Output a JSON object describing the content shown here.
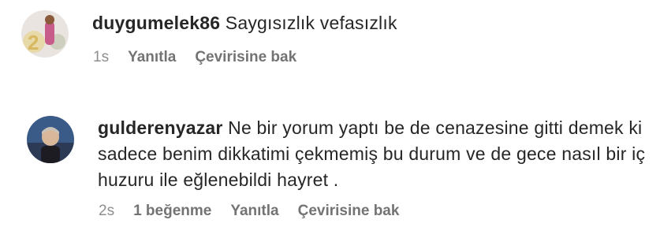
{
  "comments": [
    {
      "username": "duygumelek86",
      "text": "Saygısızlık vefasızlık",
      "time": "1s",
      "reply_label": "Yanıtla",
      "translate_label": "Çevirisine bak"
    },
    {
      "username": "gulderenyazar",
      "text": "Ne bir yorum yaptı be de cenazesine gitti demek ki sadece benim dikkatimi çekmemiş bu durum ve de gece nasıl bir iç huzuru ile eğlenebildi hayret .",
      "time": "2s",
      "likes_label": "1 beğenme",
      "reply_label": "Yanıtla",
      "translate_label": "Çevirisine bak"
    }
  ]
}
